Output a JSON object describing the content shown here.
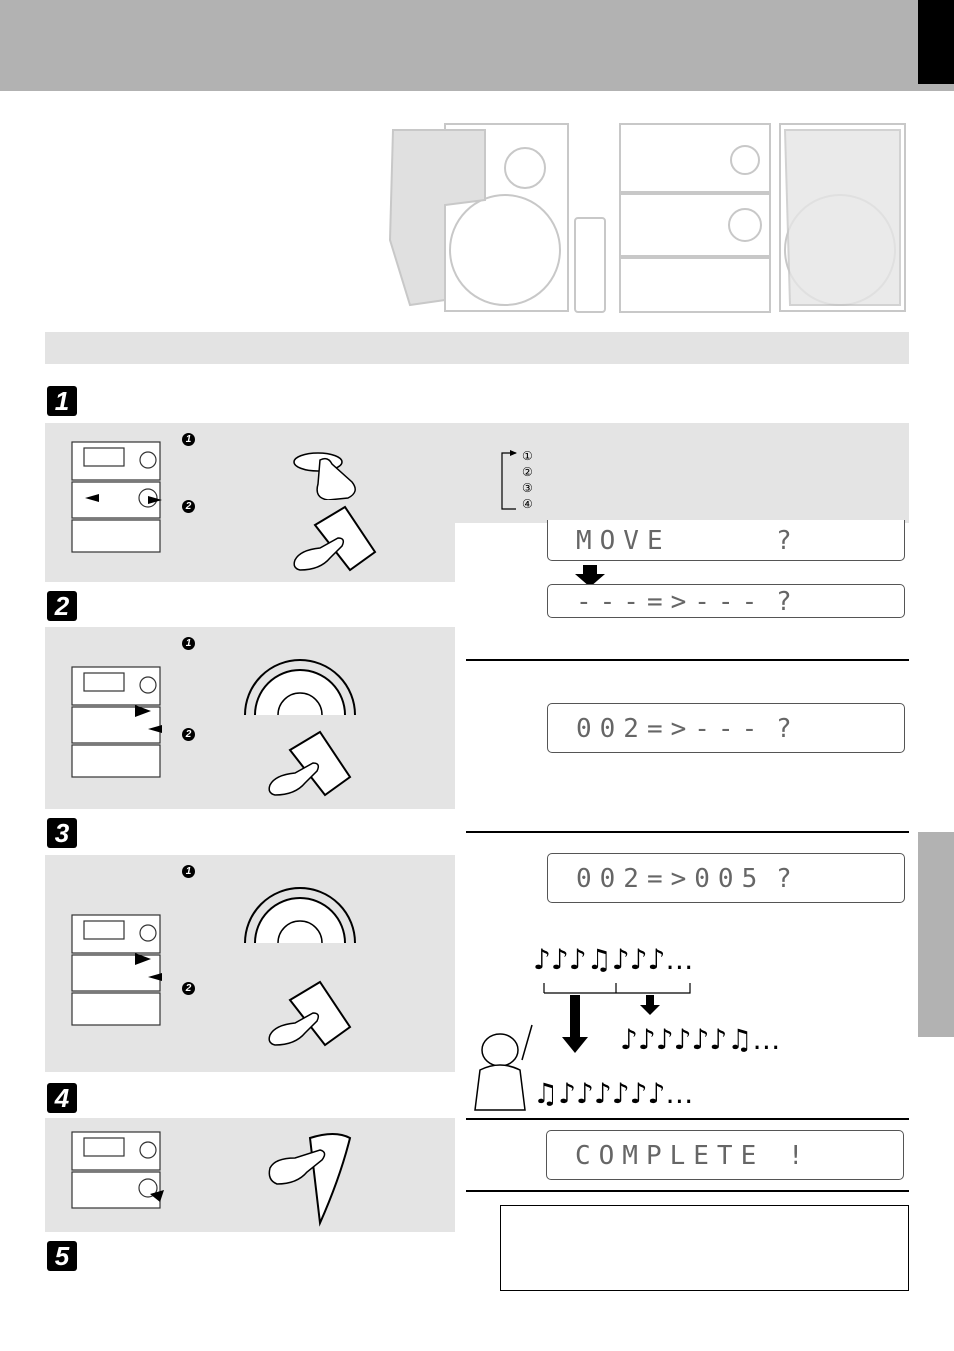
{
  "header": {
    "tab_color": "#000000",
    "band_color": "#b2b2b2"
  },
  "steps": [
    {
      "number": "1",
      "sub_markers": [
        "1",
        "2"
      ]
    },
    {
      "number": "2",
      "sub_markers": [
        "1",
        "2"
      ]
    },
    {
      "number": "3",
      "sub_markers": [
        "1",
        "2"
      ]
    },
    {
      "number": "4",
      "sub_markers": []
    },
    {
      "number": "5",
      "sub_markers": []
    }
  ],
  "cycle_list": [
    "①",
    "②",
    "③",
    "④"
  ],
  "displays": {
    "move": "MOVE",
    "select_from": "---=>---",
    "select_to": "002=>---",
    "confirm": "002=>005",
    "complete": "COMPLETE !",
    "question_mark": "?"
  },
  "illustration": {
    "row_original": "♪♪♪♫♪♪♪…",
    "row_moved_after": "♪♪♪♪♪♪♫…",
    "row_moved_before": "♫♪♪♪♪♪♪…"
  }
}
